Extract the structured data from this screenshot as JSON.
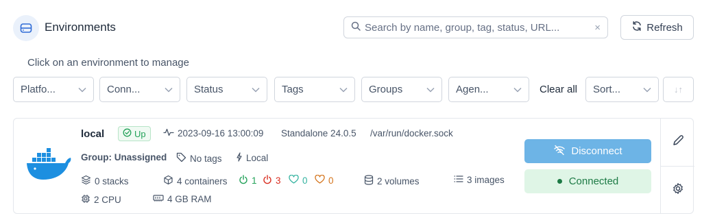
{
  "header": {
    "title": "Environments",
    "icon": "server-icon",
    "search_placeholder": "Search by name, group, tag, status, URL...",
    "clear_glyph": "×",
    "refresh_label": "Refresh"
  },
  "hint": "Click on an environment to manage",
  "filters": {
    "items": [
      {
        "label": "Platfo..."
      },
      {
        "label": "Conn..."
      },
      {
        "label": "Status"
      },
      {
        "label": "Tags"
      },
      {
        "label": "Groups"
      },
      {
        "label": "Agen..."
      }
    ],
    "clear_all": "Clear all",
    "sort_label": "Sort...",
    "sort_order_glyph": "↓↑"
  },
  "environment": {
    "name": "local",
    "status": "Up",
    "timestamp": "2023-09-16 13:00:09",
    "type": "Standalone 24.0.5",
    "url": "/var/run/docker.sock",
    "group": "Group: Unassigned",
    "tags": "No tags",
    "location": "Local",
    "stacks": "0 stacks",
    "containers": "4 containers",
    "running": "1",
    "stopped": "3",
    "healthy": "0",
    "unhealthy": "0",
    "volumes": "2 volumes",
    "images": "3 images",
    "cpu": "2 CPU",
    "ram": "4 GB RAM",
    "disconnect_label": "Disconnect",
    "connection_status": "Connected"
  },
  "colors": {
    "accent": "#6db4e6",
    "success": "#22a158",
    "danger": "#d92d20",
    "warning": "#d4741c",
    "healthy": "#34b3a0",
    "docker": "#1d8fe0"
  }
}
